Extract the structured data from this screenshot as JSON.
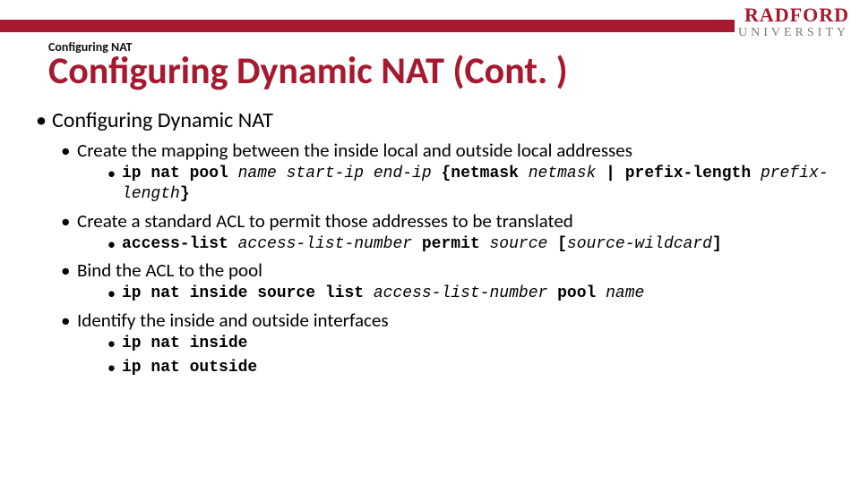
{
  "logo": {
    "main": "RADFORD",
    "sub": "UNIVERSITY"
  },
  "section_label": "Configuring NAT",
  "title": "Configuring Dynamic NAT (Cont. )",
  "colors": {
    "accent": "#a6192e"
  },
  "body": {
    "b1": "Configuring Dynamic NAT",
    "b2a": "Create the mapping between the inside local and outside local addresses",
    "cmd1": {
      "k1": "ip nat pool ",
      "a1": "name start-ip end-ip ",
      "k2": "{netmask ",
      "a2": "netmask ",
      "k3": "| prefix-length ",
      "a3": "prefix-length",
      "k4": "}"
    },
    "b2b": "Create a standard ACL to permit those addresses to be translated",
    "cmd2": {
      "k1": "access-list ",
      "a1": "access-list-number ",
      "k2": "permit ",
      "a2": "source ",
      "k3": "[",
      "a3": "source-wildcard",
      "k4": "]"
    },
    "b2c": "Bind the ACL to the pool",
    "cmd3": {
      "k1": "ip nat inside source list ",
      "a1": "access-list-number ",
      "k2": "pool ",
      "a2": "name"
    },
    "b2d": "Identify the inside and outside interfaces",
    "cmd4": {
      "k1": "ip nat inside"
    },
    "cmd5": {
      "k1": "ip nat outside"
    }
  }
}
